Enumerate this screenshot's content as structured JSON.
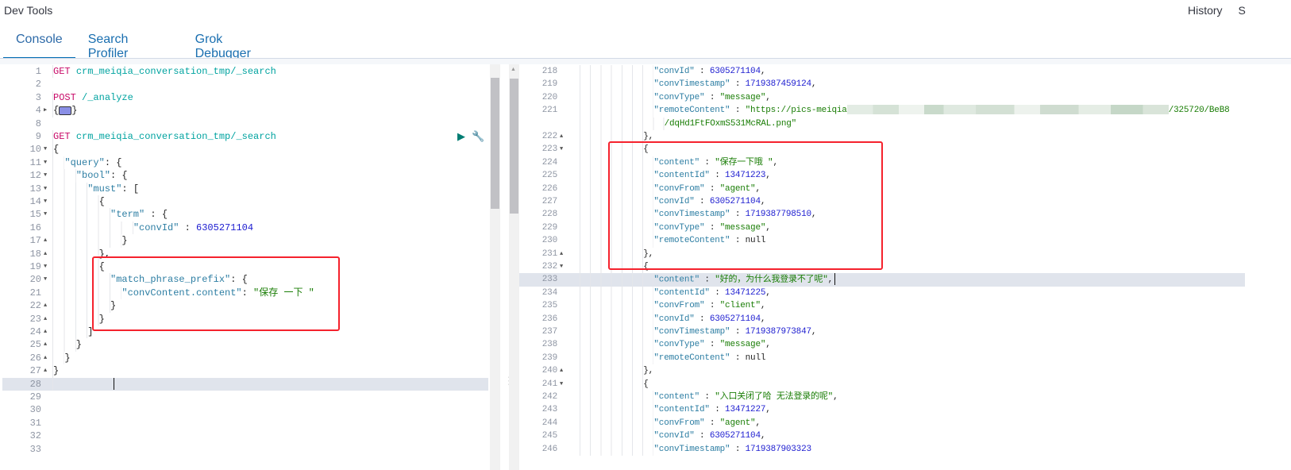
{
  "app_title": "Dev Tools",
  "top_links": [
    "History",
    "S"
  ],
  "tabs": [
    {
      "label": "Console",
      "active": true
    },
    {
      "label": "Search Profiler",
      "active": false
    },
    {
      "label": "Grok Debugger",
      "active": false
    }
  ],
  "colors": {
    "accent": "#006bb4",
    "highlight_box": "#f5222d",
    "run_button": "#017d73"
  },
  "request_editor": {
    "icons": [
      "play-icon",
      "wrench-icon"
    ],
    "lines": [
      {
        "n": "1",
        "i": 0,
        "t": [
          [
            "m",
            "GET"
          ],
          [
            "p",
            " "
          ],
          [
            "u",
            "crm_meiqia_conversation_tmp/_search"
          ]
        ]
      },
      {
        "n": "2",
        "i": 0,
        "t": []
      },
      {
        "n": "3",
        "i": 0,
        "t": [
          [
            "m",
            "POST"
          ],
          [
            "p",
            " "
          ],
          [
            "u",
            "/_analyze"
          ]
        ]
      },
      {
        "n": "4",
        "f": "r",
        "i": 0,
        "t": [
          [
            "p",
            "{"
          ],
          [
            "w",
            ""
          ],
          [
            "p",
            "}"
          ]
        ]
      },
      {
        "n": "8",
        "i": 0,
        "t": []
      },
      {
        "n": "9",
        "i": 0,
        "t": [
          [
            "m",
            "GET"
          ],
          [
            "p",
            " "
          ],
          [
            "u",
            "crm_meiqia_conversation_tmp/_search"
          ]
        ],
        "actions": true
      },
      {
        "n": "10",
        "f": "d",
        "i": 0,
        "t": [
          [
            "p",
            "{"
          ]
        ]
      },
      {
        "n": "11",
        "f": "d",
        "i": 2,
        "t": [
          [
            "k",
            "\"query\""
          ],
          [
            "p",
            ": {"
          ]
        ]
      },
      {
        "n": "12",
        "f": "d",
        "i": 4,
        "t": [
          [
            "k",
            "\"bool\""
          ],
          [
            "p",
            ": {"
          ]
        ]
      },
      {
        "n": "13",
        "f": "d",
        "i": 6,
        "t": [
          [
            "k",
            "\"must\""
          ],
          [
            "p",
            ": ["
          ]
        ]
      },
      {
        "n": "14",
        "f": "d",
        "i": 8,
        "t": [
          [
            "p",
            "{"
          ]
        ]
      },
      {
        "n": "15",
        "f": "d",
        "i": 10,
        "t": [
          [
            "k",
            "\"term\""
          ],
          [
            "p",
            " : {"
          ]
        ]
      },
      {
        "n": "16",
        "i": 14,
        "t": [
          [
            "k",
            "\"convId\""
          ],
          [
            "p",
            " : "
          ],
          [
            "n",
            "6305271104"
          ]
        ]
      },
      {
        "n": "17",
        "f": "u",
        "i": 12,
        "t": [
          [
            "p",
            "}"
          ]
        ]
      },
      {
        "n": "18",
        "f": "u",
        "i": 8,
        "t": [
          [
            "p",
            "},"
          ]
        ]
      },
      {
        "n": "19",
        "f": "d",
        "i": 8,
        "t": [
          [
            "p",
            "{"
          ]
        ]
      },
      {
        "n": "20",
        "f": "d",
        "i": 10,
        "t": [
          [
            "k",
            "\"match_phrase_prefix\""
          ],
          [
            "p",
            ": {"
          ]
        ]
      },
      {
        "n": "21",
        "i": 12,
        "t": [
          [
            "k",
            "\"convContent.content\""
          ],
          [
            "p",
            ": "
          ],
          [
            "s",
            "\"保存 一下 \""
          ]
        ]
      },
      {
        "n": "22",
        "f": "u",
        "i": 10,
        "t": [
          [
            "p",
            "}"
          ]
        ]
      },
      {
        "n": "23",
        "f": "u",
        "i": 8,
        "t": [
          [
            "p",
            "}"
          ]
        ]
      },
      {
        "n": "24",
        "f": "u",
        "i": 6,
        "t": [
          [
            "p",
            "]"
          ]
        ]
      },
      {
        "n": "25",
        "f": "u",
        "i": 4,
        "t": [
          [
            "p",
            "}"
          ]
        ]
      },
      {
        "n": "26",
        "f": "u",
        "i": 2,
        "t": [
          [
            "p",
            "}"
          ]
        ]
      },
      {
        "n": "27",
        "f": "u",
        "i": 0,
        "t": [
          [
            "p",
            "}"
          ]
        ]
      },
      {
        "n": "28",
        "i": 0,
        "t": [],
        "active": true
      },
      {
        "n": "29",
        "i": 0,
        "t": []
      },
      {
        "n": "30",
        "i": 0,
        "t": []
      },
      {
        "n": "31",
        "i": 0,
        "t": []
      },
      {
        "n": "32",
        "i": 0,
        "t": []
      },
      {
        "n": "33",
        "i": 0,
        "t": []
      }
    ]
  },
  "response_viewer": {
    "lines": [
      {
        "n": "218",
        "i": 14,
        "t": [
          [
            "k",
            "\"convId\""
          ],
          [
            "p",
            " : "
          ],
          [
            "n",
            "6305271104"
          ],
          [
            "p",
            ","
          ]
        ]
      },
      {
        "n": "219",
        "i": 14,
        "t": [
          [
            "k",
            "\"convTimestamp\""
          ],
          [
            "p",
            " : "
          ],
          [
            "n",
            "1719387459124"
          ],
          [
            "p",
            ","
          ]
        ]
      },
      {
        "n": "220",
        "i": 14,
        "t": [
          [
            "k",
            "\"convType\""
          ],
          [
            "p",
            " : "
          ],
          [
            "s",
            "\"message\""
          ],
          [
            "p",
            ","
          ]
        ]
      },
      {
        "n": "221",
        "i": 14,
        "t": [
          [
            "k",
            "\"remoteContent\""
          ],
          [
            "p",
            " : "
          ],
          [
            "s",
            "\"https://pics-meiqia"
          ],
          [
            "b",
            ""
          ],
          [
            "s",
            "/325720/BeB8"
          ]
        ]
      },
      {
        "n": "",
        "i": 16,
        "t": [
          [
            "s",
            "/dqHd1FtFOxmS531McRAL.png\""
          ]
        ]
      },
      {
        "n": "222",
        "f": "u",
        "i": 12,
        "t": [
          [
            "p",
            "},"
          ]
        ]
      },
      {
        "n": "223",
        "f": "d",
        "i": 12,
        "t": [
          [
            "p",
            "{"
          ]
        ]
      },
      {
        "n": "224",
        "i": 14,
        "t": [
          [
            "k",
            "\"content\""
          ],
          [
            "p",
            " : "
          ],
          [
            "s",
            "\"保存一下哦 \""
          ],
          [
            "p",
            ","
          ]
        ]
      },
      {
        "n": "225",
        "i": 14,
        "t": [
          [
            "k",
            "\"contentId\""
          ],
          [
            "p",
            " : "
          ],
          [
            "n",
            "13471223"
          ],
          [
            "p",
            ","
          ]
        ]
      },
      {
        "n": "226",
        "i": 14,
        "t": [
          [
            "k",
            "\"convFrom\""
          ],
          [
            "p",
            " : "
          ],
          [
            "s",
            "\"agent\""
          ],
          [
            "p",
            ","
          ]
        ]
      },
      {
        "n": "227",
        "i": 14,
        "t": [
          [
            "k",
            "\"convId\""
          ],
          [
            "p",
            " : "
          ],
          [
            "n",
            "6305271104"
          ],
          [
            "p",
            ","
          ]
        ]
      },
      {
        "n": "228",
        "i": 14,
        "t": [
          [
            "k",
            "\"convTimestamp\""
          ],
          [
            "p",
            " : "
          ],
          [
            "n",
            "1719387798510"
          ],
          [
            "p",
            ","
          ]
        ]
      },
      {
        "n": "229",
        "i": 14,
        "t": [
          [
            "k",
            "\"convType\""
          ],
          [
            "p",
            " : "
          ],
          [
            "s",
            "\"message\""
          ],
          [
            "p",
            ","
          ]
        ]
      },
      {
        "n": "230",
        "i": 14,
        "t": [
          [
            "k",
            "\"remoteContent\""
          ],
          [
            "p",
            " : "
          ],
          [
            "nl",
            "null"
          ]
        ]
      },
      {
        "n": "231",
        "f": "u",
        "i": 12,
        "t": [
          [
            "p",
            "},"
          ]
        ]
      },
      {
        "n": "232",
        "f": "d",
        "i": 12,
        "t": [
          [
            "p",
            "{"
          ]
        ]
      },
      {
        "n": "233",
        "i": 14,
        "t": [
          [
            "k",
            "\"content\""
          ],
          [
            "p",
            " : "
          ],
          [
            "s",
            "\"好的，为什么我登录不了呢\""
          ],
          [
            "p",
            ","
          ]
        ],
        "active": true
      },
      {
        "n": "234",
        "i": 14,
        "t": [
          [
            "k",
            "\"contentId\""
          ],
          [
            "p",
            " : "
          ],
          [
            "n",
            "13471225"
          ],
          [
            "p",
            ","
          ]
        ]
      },
      {
        "n": "235",
        "i": 14,
        "t": [
          [
            "k",
            "\"convFrom\""
          ],
          [
            "p",
            " : "
          ],
          [
            "s",
            "\"client\""
          ],
          [
            "p",
            ","
          ]
        ]
      },
      {
        "n": "236",
        "i": 14,
        "t": [
          [
            "k",
            "\"convId\""
          ],
          [
            "p",
            " : "
          ],
          [
            "n",
            "6305271104"
          ],
          [
            "p",
            ","
          ]
        ]
      },
      {
        "n": "237",
        "i": 14,
        "t": [
          [
            "k",
            "\"convTimestamp\""
          ],
          [
            "p",
            " : "
          ],
          [
            "n",
            "1719387973847"
          ],
          [
            "p",
            ","
          ]
        ]
      },
      {
        "n": "238",
        "i": 14,
        "t": [
          [
            "k",
            "\"convType\""
          ],
          [
            "p",
            " : "
          ],
          [
            "s",
            "\"message\""
          ],
          [
            "p",
            ","
          ]
        ]
      },
      {
        "n": "239",
        "i": 14,
        "t": [
          [
            "k",
            "\"remoteContent\""
          ],
          [
            "p",
            " : "
          ],
          [
            "nl",
            "null"
          ]
        ]
      },
      {
        "n": "240",
        "f": "u",
        "i": 12,
        "t": [
          [
            "p",
            "},"
          ]
        ]
      },
      {
        "n": "241",
        "f": "d",
        "i": 12,
        "t": [
          [
            "p",
            "{"
          ]
        ]
      },
      {
        "n": "242",
        "i": 14,
        "t": [
          [
            "k",
            "\"content\""
          ],
          [
            "p",
            " : "
          ],
          [
            "s",
            "\"入口关闭了哈 无法登录的呢\""
          ],
          [
            "p",
            ","
          ]
        ]
      },
      {
        "n": "243",
        "i": 14,
        "t": [
          [
            "k",
            "\"contentId\""
          ],
          [
            "p",
            " : "
          ],
          [
            "n",
            "13471227"
          ],
          [
            "p",
            ","
          ]
        ]
      },
      {
        "n": "244",
        "i": 14,
        "t": [
          [
            "k",
            "\"convFrom\""
          ],
          [
            "p",
            " : "
          ],
          [
            "s",
            "\"agent\""
          ],
          [
            "p",
            ","
          ]
        ]
      },
      {
        "n": "245",
        "i": 14,
        "t": [
          [
            "k",
            "\"convId\""
          ],
          [
            "p",
            " : "
          ],
          [
            "n",
            "6305271104"
          ],
          [
            "p",
            ","
          ]
        ]
      },
      {
        "n": "246",
        "i": 14,
        "t": [
          [
            "k",
            "\"convTimestamp\""
          ],
          [
            "p",
            " : "
          ],
          [
            "n",
            "1719387903323"
          ]
        ]
      }
    ]
  }
}
